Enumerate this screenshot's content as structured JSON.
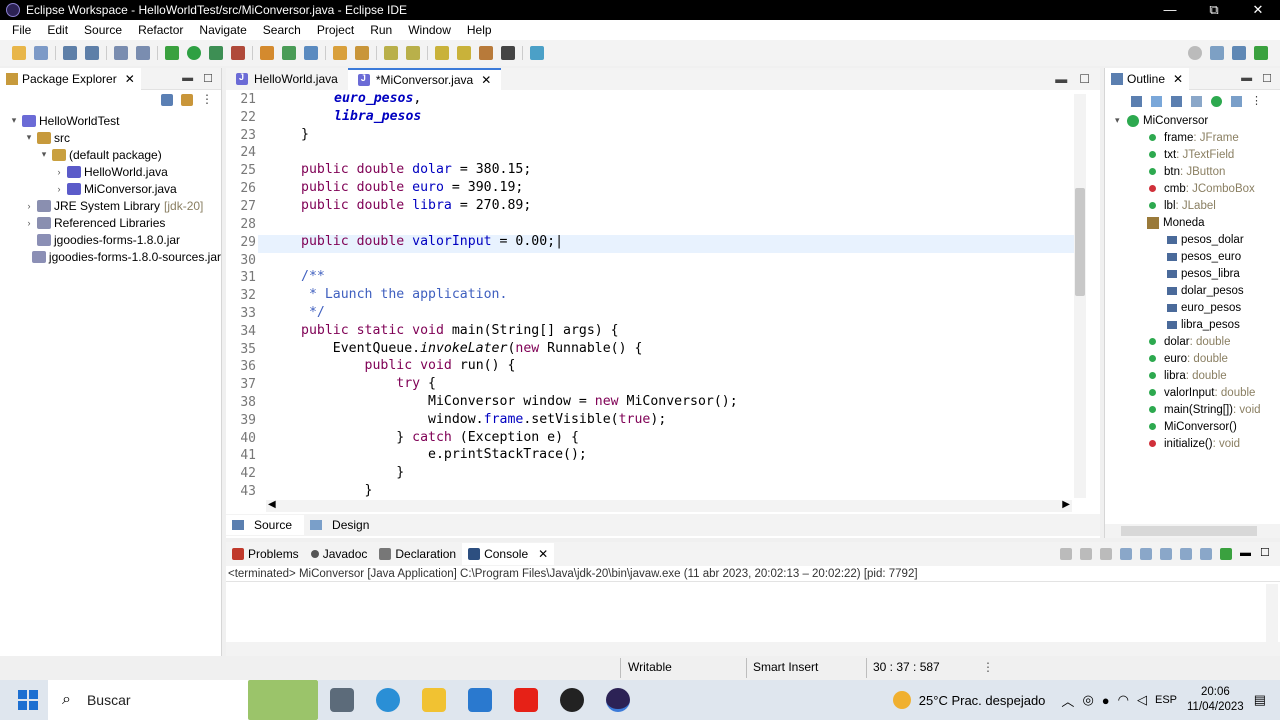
{
  "window": {
    "title": "Eclipse Workspace - HelloWorldTest/src/MiConversor.java - Eclipse IDE",
    "controls": [
      "—",
      "⧉",
      "✕"
    ]
  },
  "menu": [
    "File",
    "Edit",
    "Source",
    "Refactor",
    "Navigate",
    "Search",
    "Project",
    "Run",
    "Window",
    "Help"
  ],
  "package_explorer": {
    "title": "Package Explorer",
    "tree": [
      {
        "label": "HelloWorldTest",
        "extra": "",
        "indent": 0,
        "twisty": "▾",
        "icon": "project-icon"
      },
      {
        "label": "src",
        "extra": "",
        "indent": 1,
        "twisty": "▾",
        "icon": "folder-icon"
      },
      {
        "label": "(default package)",
        "extra": "",
        "indent": 2,
        "twisty": "▾",
        "icon": "package-icon"
      },
      {
        "label": "HelloWorld.java",
        "extra": "",
        "indent": 3,
        "twisty": "›",
        "icon": "java-file-icon"
      },
      {
        "label": "MiConversor.java",
        "extra": "",
        "indent": 3,
        "twisty": "›",
        "icon": "java-file-icon"
      },
      {
        "label": "JRE System Library",
        "extra": "[jdk-20]",
        "indent": 1,
        "twisty": "›",
        "icon": "library-icon"
      },
      {
        "label": "Referenced Libraries",
        "extra": "",
        "indent": 1,
        "twisty": "›",
        "icon": "library-icon"
      },
      {
        "label": "jgoodies-forms-1.8.0.jar",
        "extra": "",
        "indent": 1,
        "twisty": "",
        "icon": "jar-icon"
      },
      {
        "label": "jgoodies-forms-1.8.0-sources.jar",
        "extra": "",
        "indent": 1,
        "twisty": "",
        "icon": "jar-icon"
      }
    ]
  },
  "editor": {
    "tabs": [
      {
        "label": "HelloWorld.java",
        "active": false
      },
      {
        "label": "*MiConversor.java",
        "active": true
      }
    ],
    "line_numbers": [
      "21",
      "22",
      "23",
      "24",
      "25",
      "26",
      "27",
      "28",
      "29",
      "30",
      "31",
      "32",
      "33",
      "34",
      "35",
      "36",
      "37",
      "38",
      "39",
      "40",
      "41",
      "42",
      "43"
    ],
    "bottom_tabs": [
      "Source",
      "Design"
    ]
  },
  "outline": {
    "title": "Outline",
    "root": "MiConversor",
    "items": [
      {
        "name": "frame",
        "type": " : JFrame",
        "indent": 1,
        "kind": "field"
      },
      {
        "name": "txt",
        "type": " : JTextField",
        "indent": 1,
        "kind": "field"
      },
      {
        "name": "btn",
        "type": " : JButton",
        "indent": 1,
        "kind": "field"
      },
      {
        "name": "cmb",
        "type": " : JComboBox",
        "indent": 1,
        "kind": "private"
      },
      {
        "name": "lbl",
        "type": " : JLabel",
        "indent": 1,
        "kind": "field"
      },
      {
        "name": "Moneda",
        "type": "",
        "indent": 1,
        "kind": "enum"
      },
      {
        "name": "pesos_dolar",
        "type": "",
        "indent": 2,
        "kind": "const"
      },
      {
        "name": "pesos_euro",
        "type": "",
        "indent": 2,
        "kind": "const"
      },
      {
        "name": "pesos_libra",
        "type": "",
        "indent": 2,
        "kind": "const"
      },
      {
        "name": "dolar_pesos",
        "type": "",
        "indent": 2,
        "kind": "const"
      },
      {
        "name": "euro_pesos",
        "type": "",
        "indent": 2,
        "kind": "const"
      },
      {
        "name": "libra_pesos",
        "type": "",
        "indent": 2,
        "kind": "const"
      },
      {
        "name": "dolar",
        "type": " : double",
        "indent": 1,
        "kind": "field"
      },
      {
        "name": "euro",
        "type": " : double",
        "indent": 1,
        "kind": "field"
      },
      {
        "name": "libra",
        "type": " : double",
        "indent": 1,
        "kind": "field"
      },
      {
        "name": "valorInput",
        "type": " : double",
        "indent": 1,
        "kind": "field"
      },
      {
        "name": "main(String[])",
        "type": " : void",
        "indent": 1,
        "kind": "method"
      },
      {
        "name": "MiConversor()",
        "type": "",
        "indent": 1,
        "kind": "method"
      },
      {
        "name": "initialize()",
        "type": " : void",
        "indent": 1,
        "kind": "private"
      }
    ]
  },
  "console": {
    "tabs": [
      "Problems",
      "Javadoc",
      "Declaration",
      "Console"
    ],
    "active_tab": "Console",
    "status": "<terminated> MiConversor [Java Application] C:\\Program Files\\Java\\jdk-20\\bin\\javaw.exe  (11 abr 2023, 20:02:13 – 20:02:22) [pid: 7792]"
  },
  "statusbar": {
    "writable": "Writable",
    "insert": "Smart Insert",
    "position": "30 : 37 : 587"
  },
  "taskbar": {
    "search_placeholder": "Buscar",
    "weather": "25°C  Prac. despejado",
    "lang": "ESP",
    "time": "20:06",
    "date": "11/04/2023"
  },
  "colors": {
    "keyword": "#7f0055",
    "field": "#0000c0",
    "comment": "#3f5fbf",
    "accent": "#3c7bd9"
  }
}
